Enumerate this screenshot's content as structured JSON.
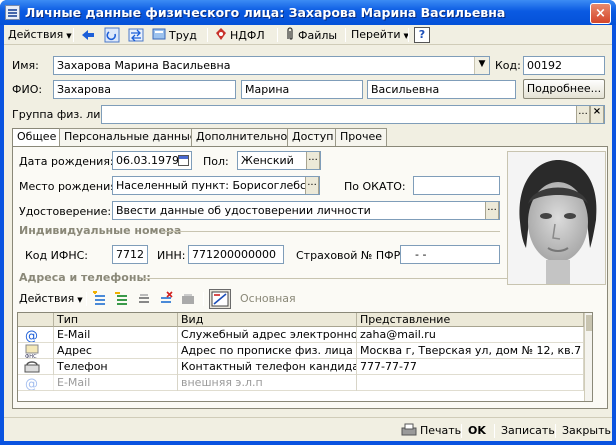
{
  "window": {
    "title": "Личные данные физического лица: Захарова Марина Васильевна",
    "close_glyph": "×"
  },
  "toolbar": {
    "actions_label": "Действия",
    "labor_label": "Труд",
    "ndfl_label": "НДФЛ",
    "files_label": "Файлы",
    "goto_label": "Перейти",
    "help_label": "?"
  },
  "form": {
    "name_label": "Имя:",
    "name_value": "Захарова Марина Васильевна",
    "code_label": "Код:",
    "code_value": "00192",
    "fio_label": "ФИО:",
    "last_name": "Захарова",
    "first_name": "Марина",
    "middle_name": "Васильевна",
    "details_button": "Подробнее...",
    "group_label": "Группа физ. лиц:",
    "group_value": ""
  },
  "tabs": [
    {
      "label": "Общее"
    },
    {
      "label": "Персональные данные"
    },
    {
      "label": "Дополнительно"
    },
    {
      "label": "Доступ"
    },
    {
      "label": "Прочее"
    }
  ],
  "general": {
    "birth_date_label": "Дата рождения:",
    "birth_date": "06.03.1979",
    "sex_label": "Пол:",
    "sex_value": "Женский",
    "birthplace_label": "Место рождения:",
    "birthplace_value": "Населенный пункт: Борисоглебск, обла",
    "okato_label": "По ОКАТО:",
    "okato_value": "",
    "id_label": "Удостоверение:",
    "id_value": "Ввести данные об удостоверении личности",
    "id_numbers_title": "Индивидуальные номера",
    "ifns_label": "Код ИФНС:",
    "ifns_value": "7712",
    "inn_label": "ИНН:",
    "inn_value": "771200000000",
    "pfr_label": "Страховой № ПФР:",
    "pfr_value": "-   -",
    "contacts_title": "Адреса и телефоны:",
    "contacts_actions": "Действия",
    "contacts_main": "Основная"
  },
  "contacts_table": {
    "columns": [
      "Тип",
      "Вид",
      "Представление"
    ],
    "rows": [
      {
        "icon": "email-icon",
        "type": "E-Mail",
        "kind": "Служебный адрес электронной ...",
        "value": "zaha@mail.ru",
        "dim": false
      },
      {
        "icon": "address-icon",
        "type": "Адрес",
        "kind": "Адрес по прописке физ. лица",
        "value": "Москва г, Тверская ул, дом № 12, кв.7",
        "dim": false
      },
      {
        "icon": "phone-icon",
        "type": "Телефон",
        "kind": "Контактный телефон кандидата",
        "value": "777-77-77",
        "dim": false
      },
      {
        "icon": "email-icon",
        "type": "E-Mail",
        "kind": "внешняя э.л.п",
        "value": "",
        "dim": true
      }
    ]
  },
  "statusbar": {
    "print_label": "Печать",
    "ok_label": "OK",
    "save_label": "Записать",
    "close_label": "Закрыть"
  },
  "colors": {
    "title_bar": "#0a5ae2",
    "window_bg": "#f1efe2",
    "section_text": "#8a8878"
  }
}
